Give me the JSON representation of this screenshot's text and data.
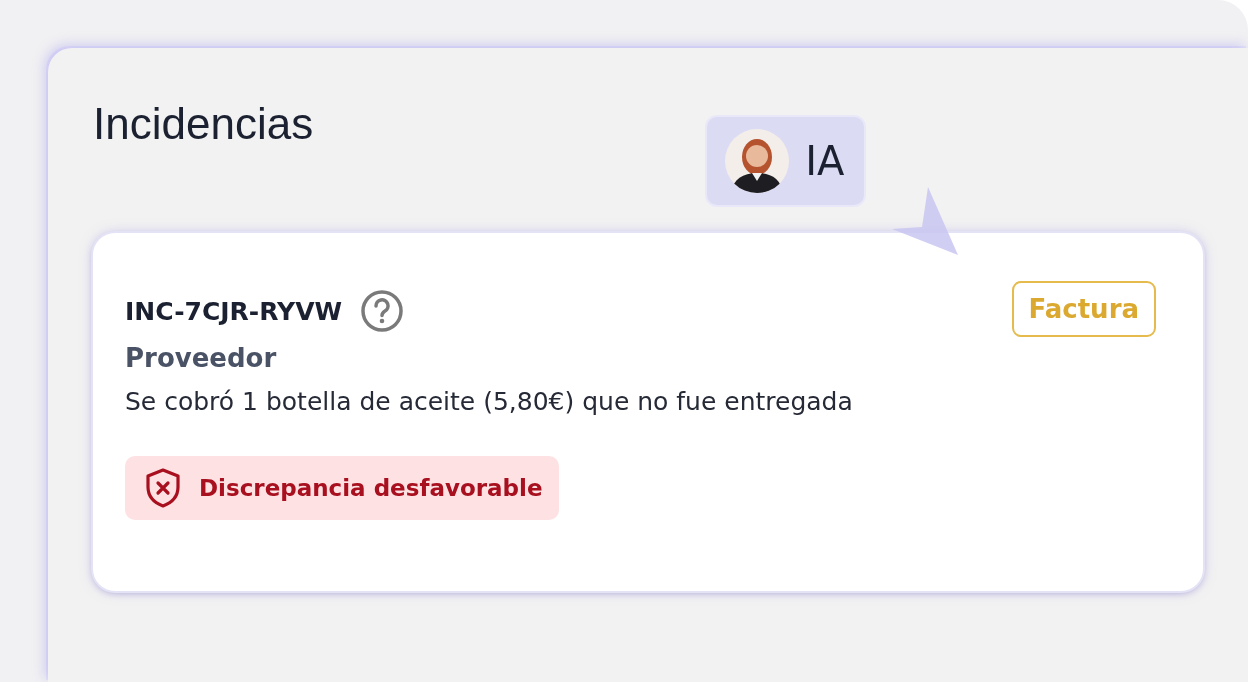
{
  "title": "Incidencias",
  "assistant_badge": {
    "label": "IA"
  },
  "incident": {
    "code": "INC-7CJR-RYVW",
    "category": "Proveedor",
    "description": "Se cobró 1 botella de aceite (5,80€) que no fue entregada",
    "tag": "Factura",
    "status": {
      "kind": "unfavorable",
      "label": "Discrepancia desfavorable"
    }
  }
}
